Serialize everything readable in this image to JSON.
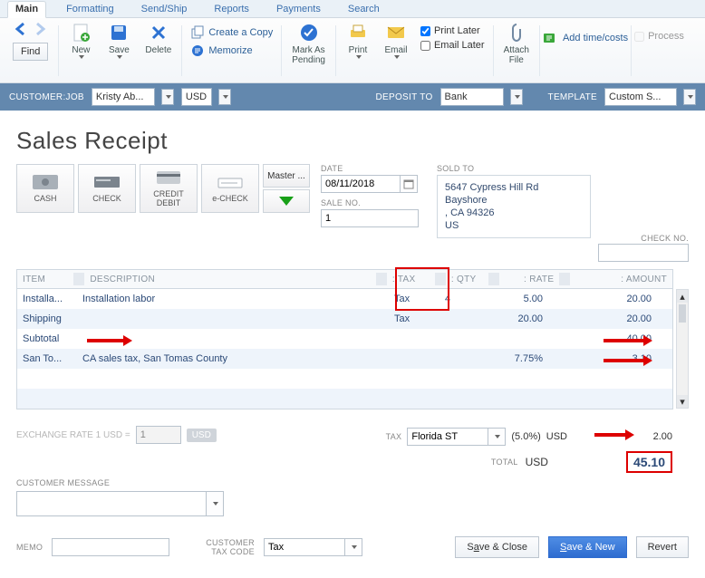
{
  "tabs": [
    "Main",
    "Formatting",
    "Send/Ship",
    "Reports",
    "Payments",
    "Search"
  ],
  "ribbon": {
    "find": "Find",
    "new": "New",
    "save": "Save",
    "delete": "Delete",
    "create_copy": "Create a Copy",
    "memorize": "Memorize",
    "mark_pending": "Mark As\nPending",
    "print": "Print",
    "email": "Email",
    "print_later": "Print Later",
    "email_later": "Email Later",
    "attach_file": "Attach\nFile",
    "add_time": "Add time/costs",
    "process": "Process"
  },
  "bluebar": {
    "customer_lbl": "CUSTOMER:JOB",
    "customer": "Kristy Ab...",
    "currency": "USD",
    "deposit_lbl": "DEPOSIT TO",
    "deposit": "Bank",
    "template_lbl": "TEMPLATE",
    "template": "Custom S..."
  },
  "title": "Sales Receipt",
  "pay": {
    "cash": "CASH",
    "check": "CHECK",
    "credit": "CREDIT\nDEBIT",
    "echeck": "e-CHECK",
    "master": "Master ..."
  },
  "date_lbl": "DATE",
  "date": "08/11/2018",
  "sale_lbl": "SALE NO.",
  "sale_no": "1",
  "soldto_lbl": "SOLD TO",
  "soldto": {
    "l1": "5647 Cypress Hill Rd",
    "l2": "Bayshore",
    "l3": ", CA 94326",
    "l4": "US"
  },
  "checkno_lbl": "CHECK NO.",
  "checkno": "",
  "cols": {
    "item": "ITEM",
    "desc": "DESCRIPTION",
    "tax": "TAX",
    "qty": "QTY",
    "rate": "RATE",
    "amt": "AMOUNT"
  },
  "rows": [
    {
      "item": "Installa...",
      "desc": "Installation labor",
      "tax": "Tax",
      "qty": "4",
      "rate": "5.00",
      "amt": "20.00"
    },
    {
      "item": "Shipping",
      "desc": "",
      "tax": "Tax",
      "qty": "",
      "rate": "20.00",
      "amt": "20.00"
    },
    {
      "item": "Subtotal",
      "desc": "",
      "tax": "",
      "qty": "",
      "rate": "",
      "amt": "40.00"
    },
    {
      "item": "San To...",
      "desc": "CA sales tax, San Tomas County",
      "tax": "",
      "qty": "",
      "rate": "7.75%",
      "amt": "3.10"
    },
    {
      "item": "",
      "desc": "",
      "tax": "",
      "qty": "",
      "rate": "",
      "amt": ""
    },
    {
      "item": "",
      "desc": "",
      "tax": "",
      "qty": "",
      "rate": "",
      "amt": ""
    }
  ],
  "exchange_lbl": "EXCHANGE RATE 1 USD =",
  "exchange_val": "1",
  "usd": "USD",
  "tax_lbl": "TAX",
  "tax_sel": "Florida ST",
  "tax_pct": "(5.0%)",
  "tax_cur": "USD",
  "tax_amt": "2.00",
  "total_lbl": "TOTAL",
  "total_cur": "USD",
  "total_amt": "45.10",
  "cust_msg_lbl": "CUSTOMER MESSAGE",
  "memo_lbl": "MEMO",
  "cust_tax_lbl": "CUSTOMER\nTAX CODE",
  "cust_tax_sel": "Tax",
  "btn_save_close": "Save & Close",
  "btn_save_new": "Save & New",
  "btn_revert": "Revert",
  "chart_data": {
    "type": "table",
    "columns": [
      "ITEM",
      "DESCRIPTION",
      "TAX",
      "QTY",
      "RATE",
      "AMOUNT"
    ],
    "rows": [
      [
        "Installa...",
        "Installation labor",
        "Tax",
        4,
        5.0,
        20.0
      ],
      [
        "Shipping",
        "",
        "Tax",
        null,
        20.0,
        20.0
      ],
      [
        "Subtotal",
        "",
        "",
        null,
        null,
        40.0
      ],
      [
        "San To...",
        "CA sales tax, San Tomas County",
        "",
        null,
        "7.75%",
        3.1
      ]
    ],
    "tax": {
      "name": "Florida ST",
      "rate_pct": 5.0,
      "amount": 2.0,
      "currency": "USD"
    },
    "total": {
      "amount": 45.1,
      "currency": "USD"
    }
  }
}
